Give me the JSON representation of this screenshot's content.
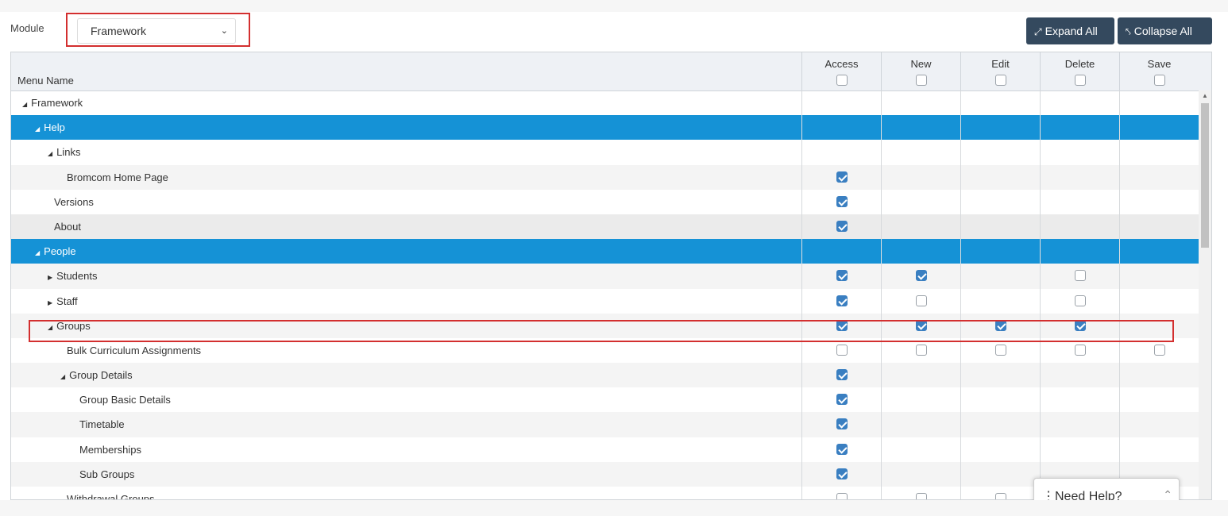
{
  "module": {
    "label": "Module",
    "selected": "Framework"
  },
  "toolbar": {
    "expand_label": "Expand All",
    "collapse_label": "Collapse All"
  },
  "header": {
    "menu_name": "Menu Name",
    "columns": [
      "Access",
      "New",
      "Edit",
      "Delete",
      "Save"
    ]
  },
  "rows": [
    {
      "label": "Framework",
      "arrow": "◢",
      "level": 0,
      "style": "plain",
      "checks": [
        null,
        null,
        null,
        null,
        null
      ]
    },
    {
      "label": "Help",
      "arrow": "◢",
      "level": 1,
      "style": "hl",
      "checks": [
        null,
        null,
        null,
        null,
        null
      ]
    },
    {
      "label": "Links",
      "arrow": "◢",
      "level": 2,
      "style": "plain",
      "checks": [
        null,
        null,
        null,
        null,
        null
      ]
    },
    {
      "label": "Bromcom Home Page",
      "arrow": "",
      "level": 3,
      "style": "alt",
      "checks": [
        true,
        null,
        null,
        null,
        null
      ]
    },
    {
      "label": "Versions",
      "arrow": "",
      "level": 2,
      "style": "plain",
      "checks": [
        true,
        null,
        null,
        null,
        null
      ]
    },
    {
      "label": "About",
      "arrow": "",
      "level": 2,
      "style": "gray",
      "checks": [
        true,
        null,
        null,
        null,
        null
      ]
    },
    {
      "label": "People",
      "arrow": "◢",
      "level": 1,
      "style": "hl",
      "checks": [
        null,
        null,
        null,
        null,
        null
      ]
    },
    {
      "label": "Students",
      "arrow": "▶",
      "level": 2,
      "style": "alt",
      "checks": [
        true,
        true,
        null,
        false,
        null
      ]
    },
    {
      "label": "Staff",
      "arrow": "▶",
      "level": 2,
      "style": "plain",
      "checks": [
        true,
        false,
        null,
        false,
        null
      ]
    },
    {
      "label": "Groups",
      "arrow": "◢",
      "level": 2,
      "style": "alt",
      "checks": [
        true,
        true,
        true,
        true,
        null
      ]
    },
    {
      "label": "Bulk Curriculum Assignments",
      "arrow": "",
      "level": 3,
      "style": "plain",
      "checks": [
        false,
        false,
        false,
        false,
        false
      ]
    },
    {
      "label": "Group Details",
      "arrow": "◢",
      "level": 3,
      "style": "alt",
      "checks": [
        true,
        null,
        null,
        null,
        null
      ]
    },
    {
      "label": "Group Basic Details",
      "arrow": "",
      "level": 4,
      "style": "plain",
      "checks": [
        true,
        null,
        null,
        null,
        null
      ]
    },
    {
      "label": "Timetable",
      "arrow": "",
      "level": 4,
      "style": "alt",
      "checks": [
        true,
        null,
        null,
        null,
        null
      ]
    },
    {
      "label": "Memberships",
      "arrow": "",
      "level": 4,
      "style": "plain",
      "checks": [
        true,
        null,
        null,
        null,
        null
      ]
    },
    {
      "label": "Sub Groups",
      "arrow": "",
      "level": 4,
      "style": "alt",
      "checks": [
        true,
        null,
        null,
        null,
        null
      ]
    },
    {
      "label": "Withdrawal Groups",
      "arrow": "",
      "level": 3,
      "style": "plain",
      "checks": [
        false,
        false,
        false,
        null,
        null
      ]
    }
  ],
  "help_widget": {
    "label": "Need Help?"
  },
  "colors": {
    "highlight": "#1592d6",
    "button": "#34495e",
    "checked": "#3a7fc1",
    "annotation": "#d32f2f"
  }
}
